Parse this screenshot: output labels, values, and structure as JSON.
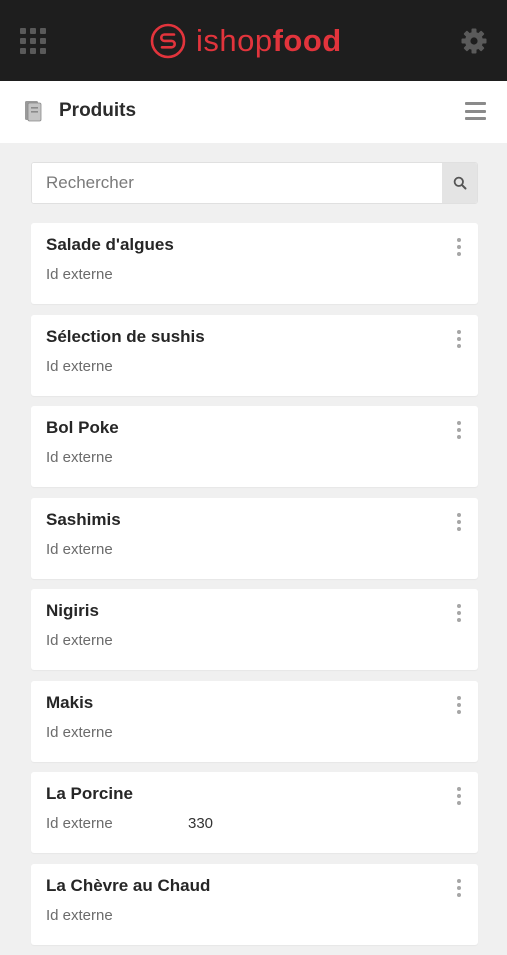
{
  "brand": {
    "name_light": "ishop",
    "name_bold": "food",
    "color": "#e2343c"
  },
  "page": {
    "title": "Produits"
  },
  "search": {
    "placeholder": "Rechercher"
  },
  "products": [
    {
      "name": "Salade d'algues",
      "external_label": "Id externe",
      "external_id": ""
    },
    {
      "name": "Sélection de sushis",
      "external_label": "Id externe",
      "external_id": ""
    },
    {
      "name": "Bol Poke",
      "external_label": "Id externe",
      "external_id": ""
    },
    {
      "name": "Sashimis",
      "external_label": "Id externe",
      "external_id": ""
    },
    {
      "name": "Nigiris",
      "external_label": "Id externe",
      "external_id": ""
    },
    {
      "name": "Makis",
      "external_label": "Id externe",
      "external_id": ""
    },
    {
      "name": "La Porcine",
      "external_label": "Id externe",
      "external_id": "330"
    },
    {
      "name": "La Chèvre au Chaud",
      "external_label": "Id externe",
      "external_id": ""
    }
  ],
  "icons": {
    "apps": "grid-icon",
    "logo": "ishopfood-logo-icon",
    "settings": "gear-icon",
    "page": "document-icon",
    "menu": "hamburger-icon",
    "search": "search-icon",
    "item_menu": "kebab-menu-icon"
  }
}
